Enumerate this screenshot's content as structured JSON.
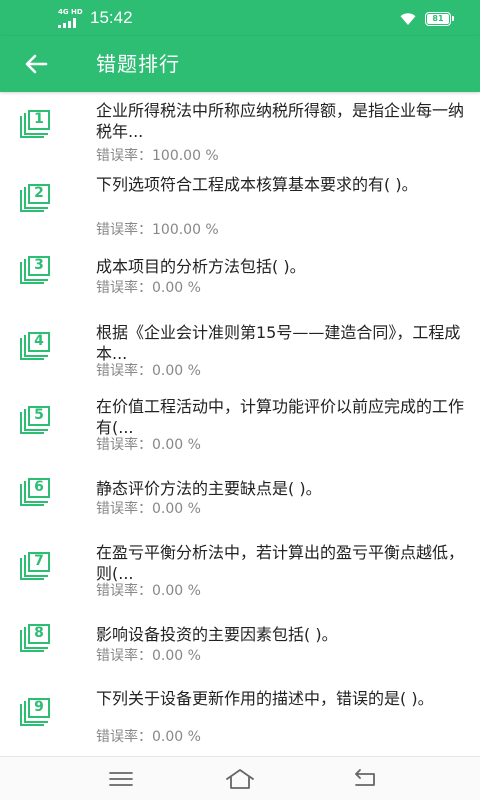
{
  "status_bar": {
    "network": "4G HD",
    "time": "15:42",
    "battery": "81"
  },
  "app_bar": {
    "title": "错题排行",
    "back_icon": "arrow-left-icon"
  },
  "items": [
    {
      "rank": "1",
      "text": "企业所得税法中所称应纳税所得额，是指企业每一纳税年...",
      "rate": "错误率：100.00 %"
    },
    {
      "rank": "2",
      "text": "下列选项符合工程成本核算基本要求的有( )。",
      "rate": "错误率：100.00 %"
    },
    {
      "rank": "3",
      "text": "成本项目的分析方法包括( )。",
      "rate": "错误率：0.00 %"
    },
    {
      "rank": "4",
      "text": "根据《企业会计准则第15号——建造合同》，工程成本...",
      "rate": "错误率：0.00 %"
    },
    {
      "rank": "5",
      "text": "在价值工程活动中，计算功能评价以前应完成的工作有(...",
      "rate": "错误率：0.00 %"
    },
    {
      "rank": "6",
      "text": "静态评价方法的主要缺点是( )。",
      "rate": "错误率：0.00 %"
    },
    {
      "rank": "7",
      "text": "在盈亏平衡分析法中，若计算出的盈亏平衡点越低，则(...",
      "rate": "错误率：0.00 %"
    },
    {
      "rank": "8",
      "text": "影响设备投资的主要因素包括( )。",
      "rate": "错误率：0.00 %"
    },
    {
      "rank": "9",
      "text": "下列关于设备更新作用的描述中，错误的是( )。",
      "rate": "错误率：0.00 %"
    }
  ],
  "nav_bar": {
    "menu_icon": "menu-icon",
    "home_icon": "home-icon",
    "back_icon": "back-icon"
  },
  "colors": {
    "accent": "#2dbd73",
    "rate_text": "#888888"
  }
}
